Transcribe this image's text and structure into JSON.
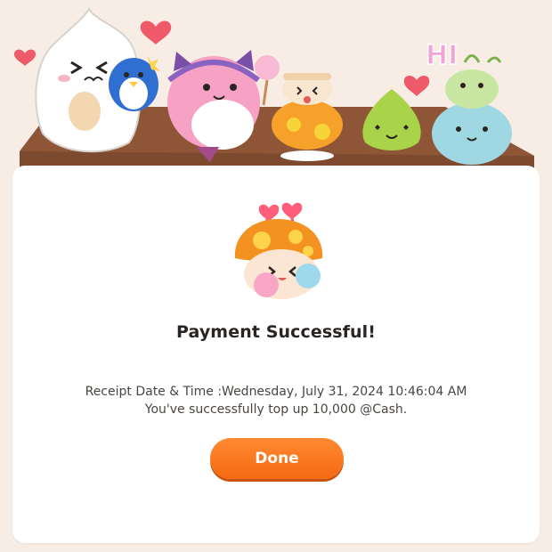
{
  "dialog": {
    "title": "Payment Successful!",
    "receipt_label": "Receipt Date & Time :Wednesday, July 31, 2024 10:46:04 AM",
    "message": "You've successfully top up 10,000 @Cash.",
    "done_label": "Done"
  },
  "illustration": {
    "speech_text": "HI"
  },
  "colors": {
    "background": "#f7ede4",
    "card": "#ffffff",
    "button": "#f56a12",
    "title_text": "#2a2522",
    "body_text": "#4a4540",
    "heart": "#ef5a6a"
  },
  "icons": [
    "heart-icon",
    "yeti-mascot",
    "penguin-mascot",
    "pink-bean-mascot",
    "mushroom-mascot",
    "slime-mascot",
    "blue-slime-mascot",
    "green-sprout-mascot",
    "orange-mushroom-mascot"
  ]
}
